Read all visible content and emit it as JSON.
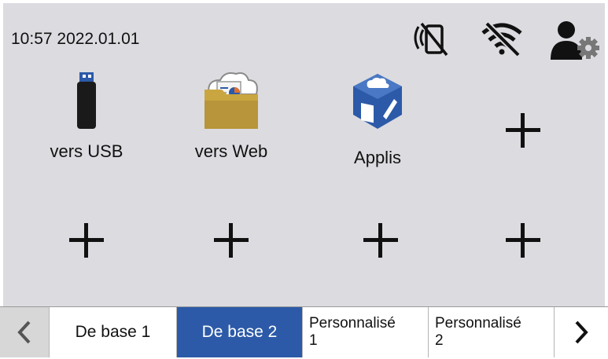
{
  "status_bar": {
    "datetime": "10:57 2022.01.01",
    "icons": [
      "nfc-disabled-icon",
      "wifi-disabled-icon",
      "admin-settings-icon"
    ]
  },
  "shortcuts": [
    {
      "label": "vers USB",
      "icon": "usb-drive-icon"
    },
    {
      "label": "vers Web",
      "icon": "web-folder-icon"
    },
    {
      "label": "Applis",
      "icon": "apps-icon"
    }
  ],
  "add_slots": 5,
  "tabs": {
    "prev_icon": "chevron-left-icon",
    "items": [
      {
        "line1": "De base 1",
        "line2": ""
      },
      {
        "line1": "De base 2",
        "line2": ""
      },
      {
        "line1": "Personnalisé",
        "line2": "1"
      },
      {
        "line1": "Personnalisé",
        "line2": "2"
      }
    ],
    "active": "De base 2",
    "next_icon": "chevron-right-icon"
  },
  "colors": {
    "background": "#dcdbe0",
    "active_tab": "#2c5aa8",
    "app_icon": "#2c5aa8",
    "folder": "#c9a640"
  }
}
